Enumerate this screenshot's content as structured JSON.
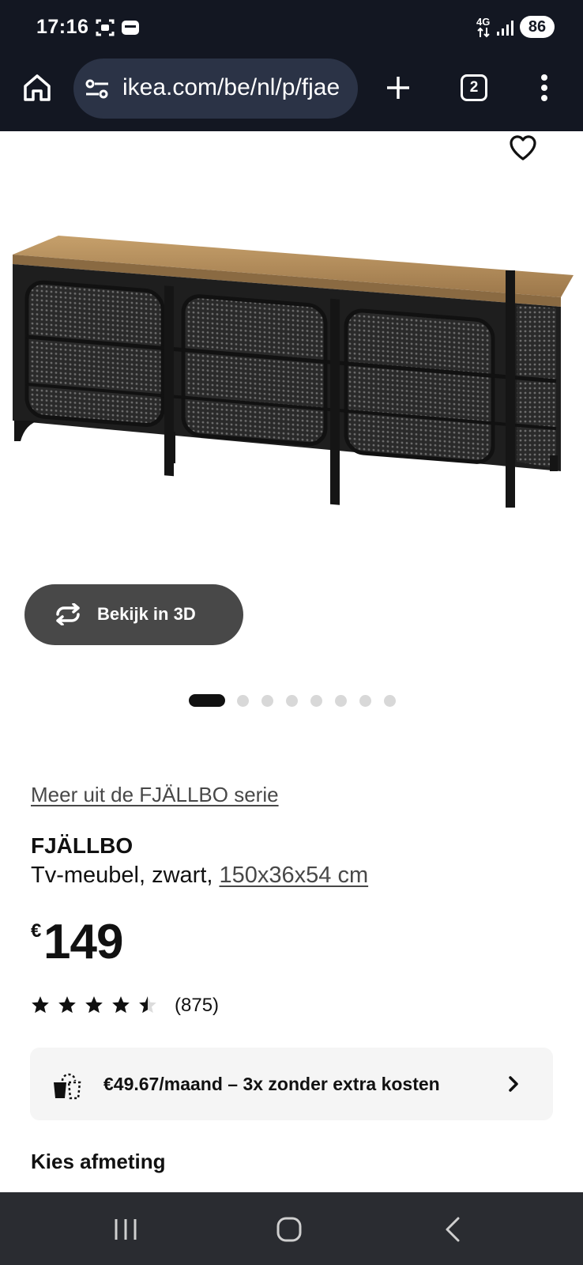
{
  "status_bar": {
    "time": "17:16",
    "network": "4G",
    "battery": "86"
  },
  "browser": {
    "url": "ikea.com/be/nl/p/fjae",
    "tab_count": "2"
  },
  "gallery": {
    "view_3d_label": "Bekijk in 3D",
    "image_count": 8,
    "active_index": 0
  },
  "product": {
    "series_link": "Meer uit de FJÄLLBO serie",
    "name": "FJÄLLBO",
    "description": "Tv-meubel, zwart, ",
    "dimensions": "150x36x54 cm",
    "currency": "€",
    "price": "149",
    "rating": 4.5,
    "review_count": "(875)"
  },
  "financing": {
    "text": "€49.67/maand – 3x zonder extra kosten"
  },
  "size_section": {
    "title": "Kies afmeting"
  },
  "colors": {
    "chrome_bg": "#131722",
    "urlbar_bg": "#2b3346",
    "button_3d_bg": "#484848",
    "star": "#111111",
    "nav_bg": "#2a2c31"
  }
}
